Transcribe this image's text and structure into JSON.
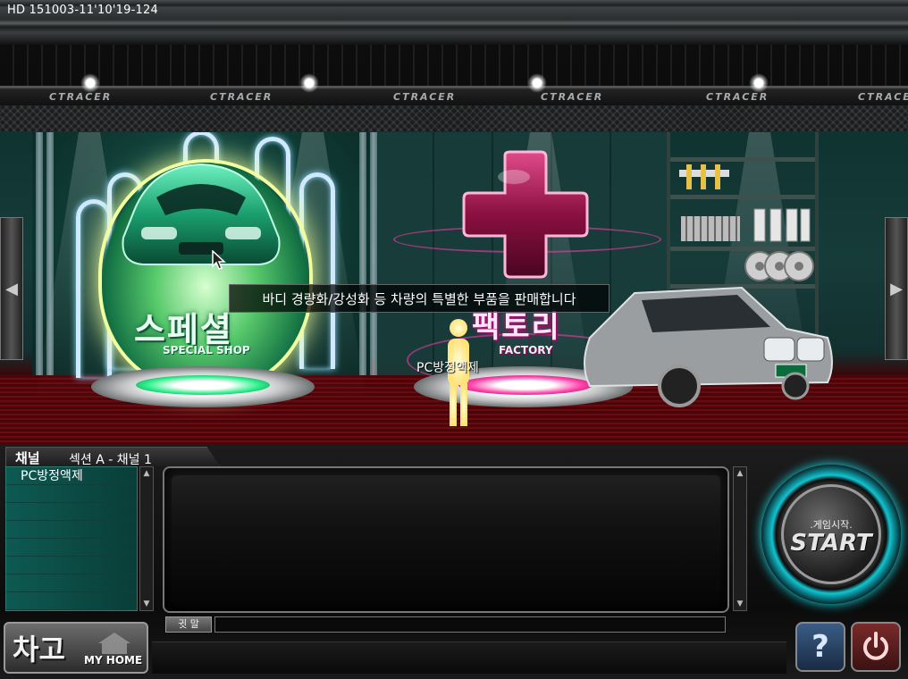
{
  "hud": {
    "id_label": "HD 151003-11'10'19-124"
  },
  "ceiling": {
    "brands": [
      "CTRACER",
      "CTRACER",
      "CTRACER",
      "CTRACER",
      "CTRACER",
      "CTRACER"
    ]
  },
  "special_shop": {
    "title_kr": "스페셜",
    "title_en": "SPECIAL SHOP"
  },
  "factory": {
    "title_kr": "팩토리",
    "title_en": "FACTORY"
  },
  "tooltip": {
    "text": "바디 경량화/강성화 등 차량의 특별한 부품을 판매합니다"
  },
  "player": {
    "name": "PC방정액제"
  },
  "channel": {
    "tab_label": "채널",
    "name": "섹션 A - 채널 1"
  },
  "user_list": {
    "users": [
      "PC방정액제",
      "",
      "",
      "",
      "",
      "",
      "",
      ""
    ]
  },
  "chat": {
    "whisper_label": "귓 말",
    "input_value": ""
  },
  "start": {
    "label_kr": ".게임시작.",
    "label_en": "START"
  },
  "myhome": {
    "label_kr": "차고",
    "label_en": "MY HOME"
  },
  "icons": {
    "help": "?",
    "power": "power-icon"
  },
  "colors": {
    "accent_cyan": "#11c4d0",
    "shop_green": "#0f6b41",
    "factory_pink": "#c2188a",
    "floor_red": "#6b0a10"
  }
}
